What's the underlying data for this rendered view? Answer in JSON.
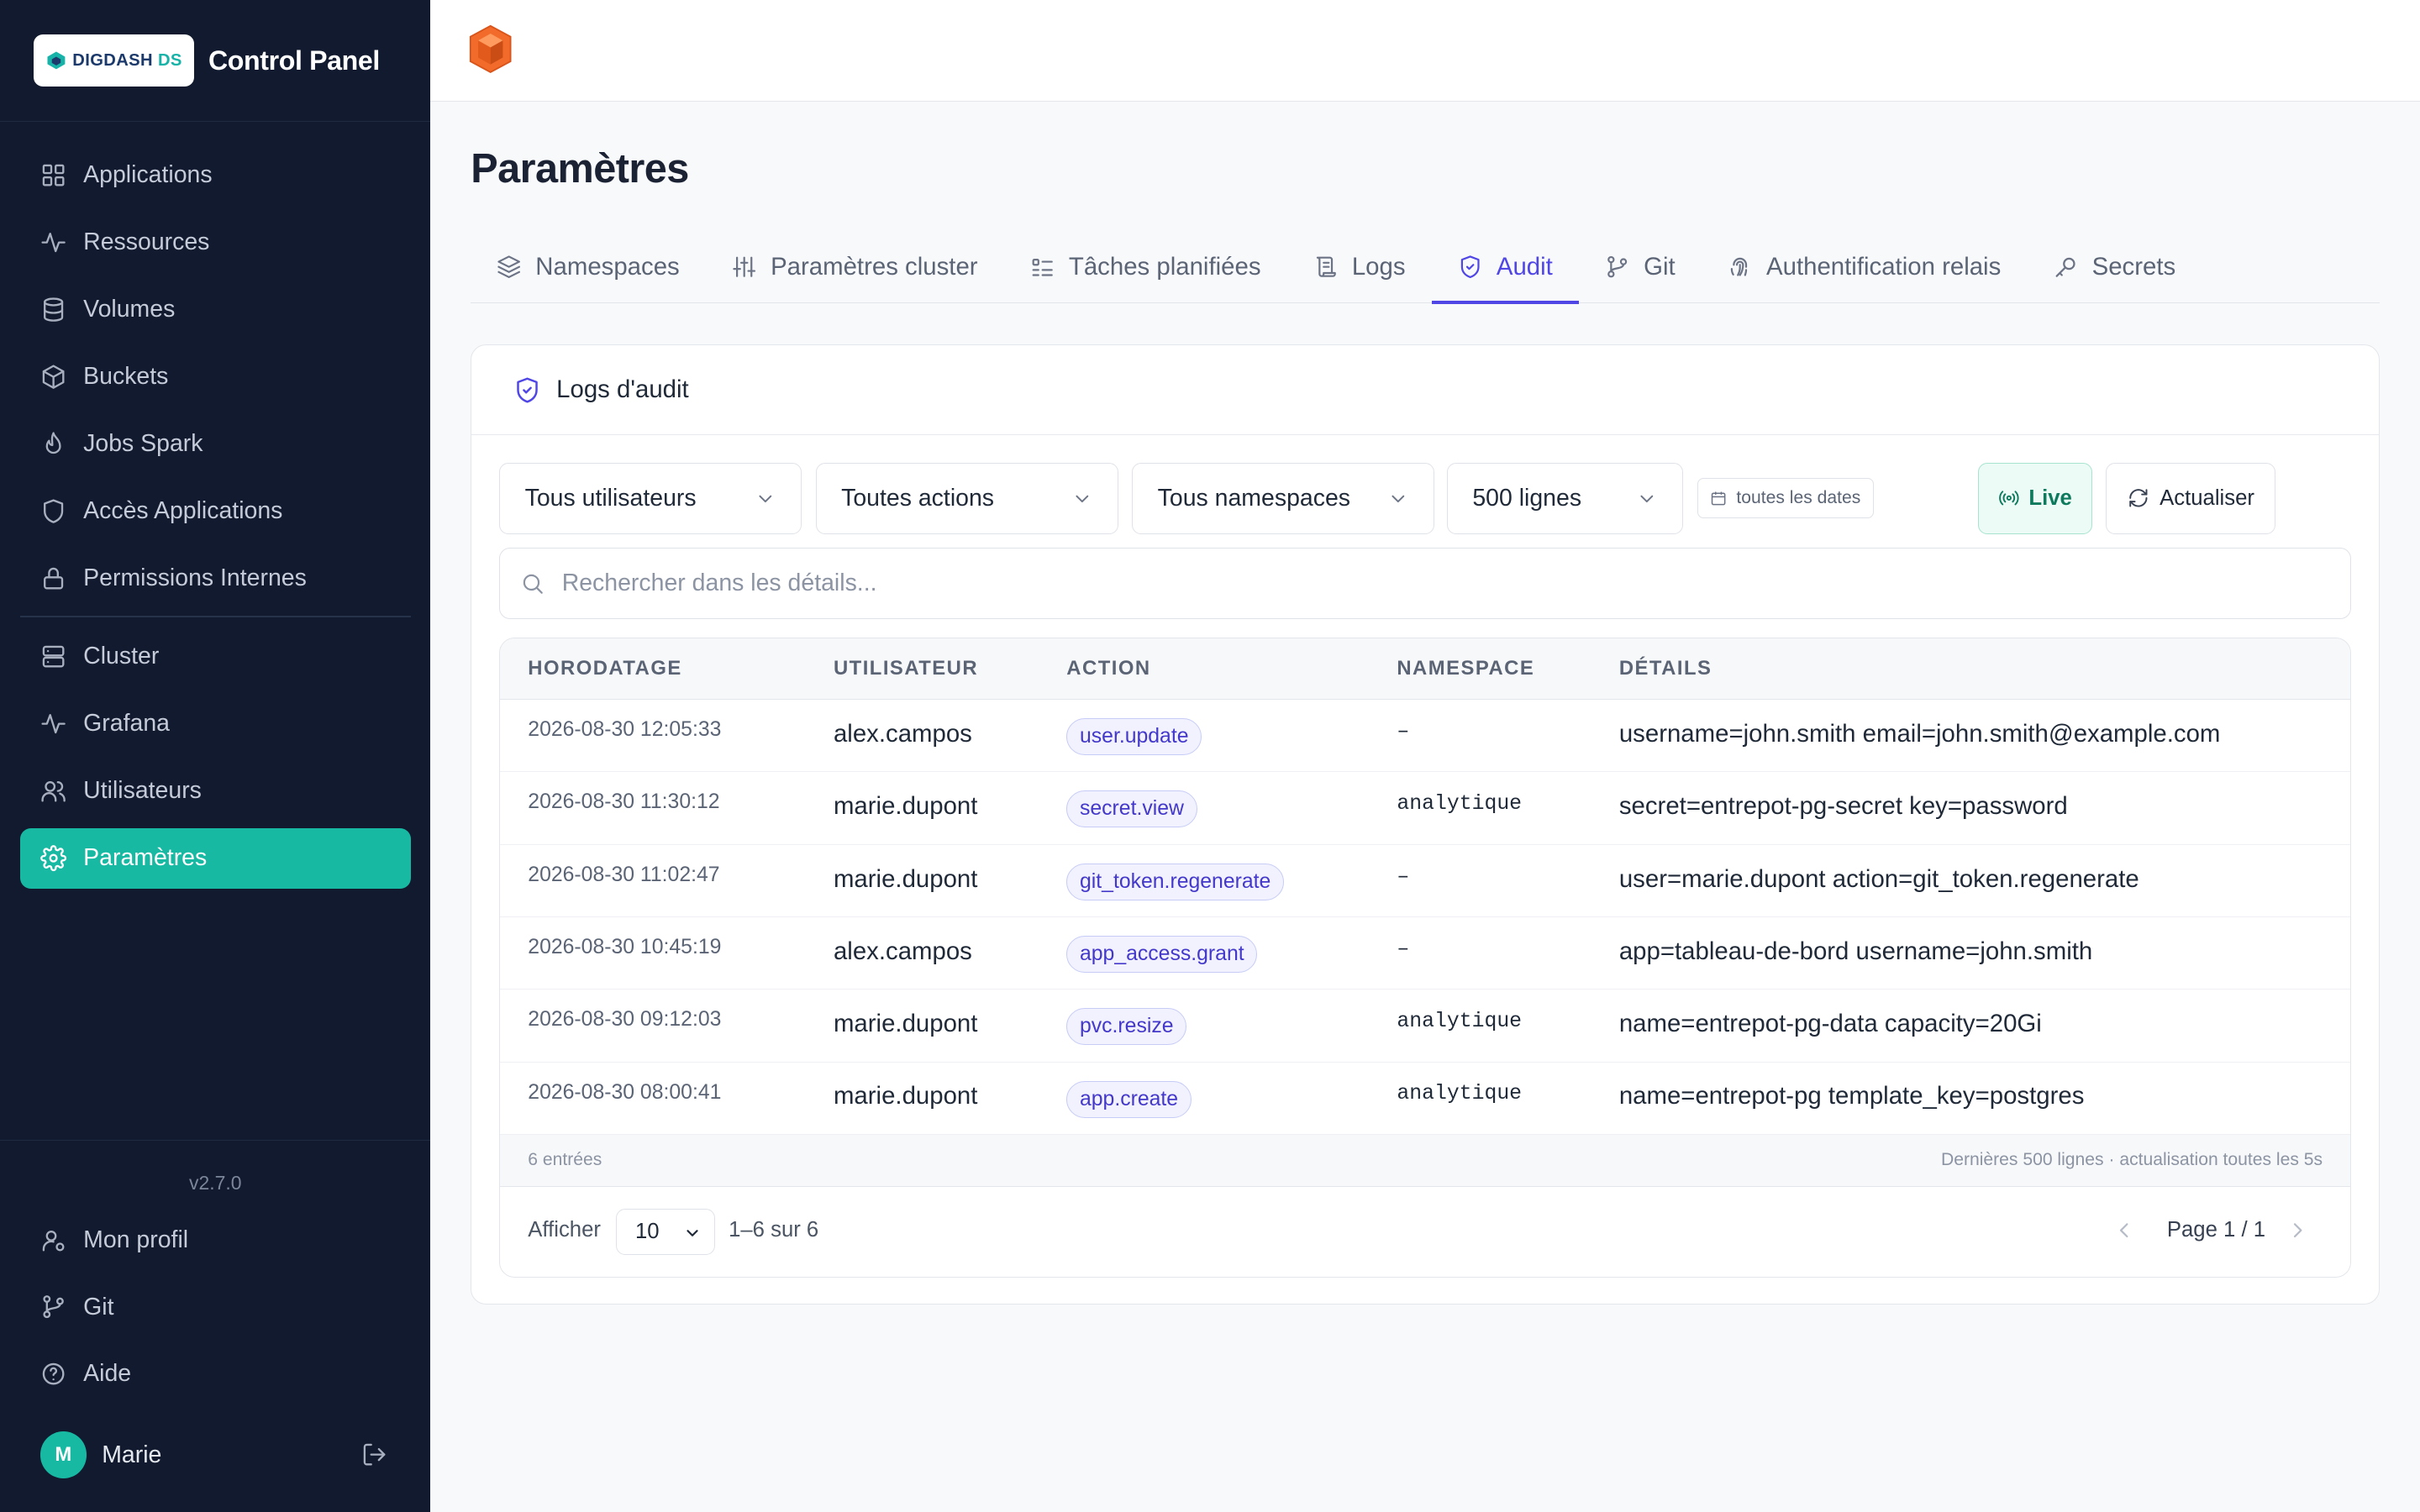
{
  "app": {
    "brand_text": "DIGDASH",
    "brand_suffix": "DS",
    "title": "Control Panel",
    "version": "v2.7.0"
  },
  "sidebar": {
    "items": [
      {
        "label": "Applications",
        "icon": "grid-icon"
      },
      {
        "label": "Ressources",
        "icon": "activity-icon"
      },
      {
        "label": "Volumes",
        "icon": "database-icon"
      },
      {
        "label": "Buckets",
        "icon": "box-icon"
      },
      {
        "label": "Jobs Spark",
        "icon": "flame-icon"
      },
      {
        "label": "Accès Applications",
        "icon": "shield-icon"
      },
      {
        "label": "Permissions Internes",
        "icon": "lock-icon"
      },
      {
        "label": "Cluster",
        "icon": "server-icon"
      },
      {
        "label": "Grafana",
        "icon": "activity-icon"
      },
      {
        "label": "Utilisateurs",
        "icon": "users-icon"
      },
      {
        "label": "Paramètres",
        "icon": "gear-icon",
        "active": true
      }
    ],
    "bottom": [
      {
        "label": "Mon profil",
        "icon": "user-cog-icon"
      },
      {
        "label": "Git",
        "icon": "git-branch-icon"
      },
      {
        "label": "Aide",
        "icon": "help-circle-icon"
      }
    ],
    "user": {
      "initial": "M",
      "name": "Marie"
    }
  },
  "page": {
    "title": "Paramètres",
    "tabs": [
      {
        "label": "Namespaces",
        "icon": "layers-icon"
      },
      {
        "label": "Paramètres cluster",
        "icon": "sliders-icon"
      },
      {
        "label": "Tâches planifiées",
        "icon": "list-todo-icon"
      },
      {
        "label": "Logs",
        "icon": "scroll-icon"
      },
      {
        "label": "Audit",
        "icon": "shield-check-icon",
        "active": true
      },
      {
        "label": "Git",
        "icon": "git-branch-icon"
      },
      {
        "label": "Authentification relais",
        "icon": "fingerprint-icon"
      },
      {
        "label": "Secrets",
        "icon": "key-icon"
      }
    ]
  },
  "audit": {
    "card_title": "Logs d'audit",
    "filters": {
      "users": "Tous utilisateurs",
      "actions": "Toutes actions",
      "namespaces": "Tous namespaces",
      "lines": "500 lignes",
      "dates": "toutes les dates",
      "live": "Live",
      "refresh": "Actualiser"
    },
    "search_placeholder": "Rechercher dans les détails...",
    "columns": [
      "HORODATAGE",
      "UTILISATEUR",
      "ACTION",
      "NAMESPACE",
      "DÉTAILS"
    ],
    "rows": [
      {
        "ts": "2026-08-30 12:05:33",
        "user": "alex.campos",
        "action": "user.update",
        "ns": "–",
        "details": "username=john.smith email=john.smith@example.com"
      },
      {
        "ts": "2026-08-30 11:30:12",
        "user": "marie.dupont",
        "action": "secret.view",
        "ns": "analytique",
        "details": "secret=entrepot-pg-secret key=password"
      },
      {
        "ts": "2026-08-30 11:02:47",
        "user": "marie.dupont",
        "action": "git_token.regenerate",
        "ns": "–",
        "details": "user=marie.dupont action=git_token.regenerate"
      },
      {
        "ts": "2026-08-30 10:45:19",
        "user": "alex.campos",
        "action": "app_access.grant",
        "ns": "–",
        "details": "app=tableau-de-bord username=john.smith"
      },
      {
        "ts": "2026-08-30 09:12:03",
        "user": "marie.dupont",
        "action": "pvc.resize",
        "ns": "analytique",
        "details": "name=entrepot-pg-data capacity=20Gi"
      },
      {
        "ts": "2026-08-30 08:00:41",
        "user": "marie.dupont",
        "action": "app.create",
        "ns": "analytique",
        "details": "name=entrepot-pg template_key=postgres"
      }
    ],
    "footer_count": "6 entrées",
    "footer_note": "Dernières 500 lignes · actualisation toutes les 5s",
    "pager": {
      "show_label": "Afficher",
      "per_page": "10",
      "range": "1–6 sur 6",
      "page": "Page 1 / 1"
    }
  }
}
